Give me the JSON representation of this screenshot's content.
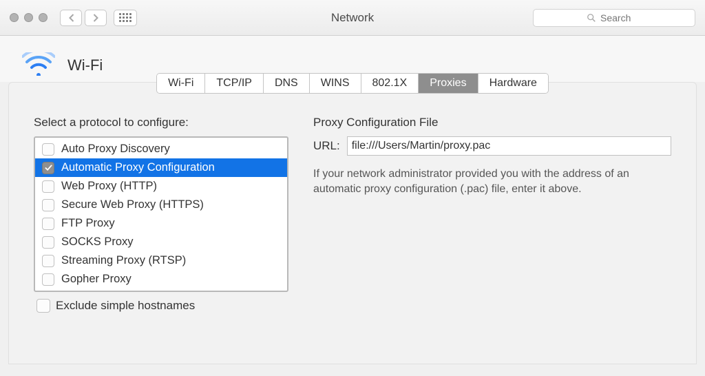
{
  "window": {
    "title": "Network",
    "search_placeholder": "Search"
  },
  "interface": {
    "name": "Wi-Fi"
  },
  "tabs": [
    {
      "label": "Wi-Fi",
      "active": false
    },
    {
      "label": "TCP/IP",
      "active": false
    },
    {
      "label": "DNS",
      "active": false
    },
    {
      "label": "WINS",
      "active": false
    },
    {
      "label": "802.1X",
      "active": false
    },
    {
      "label": "Proxies",
      "active": true
    },
    {
      "label": "Hardware",
      "active": false
    }
  ],
  "left": {
    "heading": "Select a protocol to configure:",
    "protocols": [
      {
        "label": "Auto Proxy Discovery",
        "checked": false,
        "selected": false
      },
      {
        "label": "Automatic Proxy Configuration",
        "checked": true,
        "selected": true
      },
      {
        "label": "Web Proxy (HTTP)",
        "checked": false,
        "selected": false
      },
      {
        "label": "Secure Web Proxy (HTTPS)",
        "checked": false,
        "selected": false
      },
      {
        "label": "FTP Proxy",
        "checked": false,
        "selected": false
      },
      {
        "label": "SOCKS Proxy",
        "checked": false,
        "selected": false
      },
      {
        "label": "Streaming Proxy (RTSP)",
        "checked": false,
        "selected": false
      },
      {
        "label": "Gopher Proxy",
        "checked": false,
        "selected": false
      }
    ],
    "exclude_label": "Exclude simple hostnames",
    "exclude_checked": false
  },
  "right": {
    "heading": "Proxy Configuration File",
    "url_label": "URL:",
    "url_value": "file:///Users/Martin/proxy.pac",
    "help_text": "If your network administrator provided you with the address of an automatic proxy configuration (.pac) file, enter it above."
  }
}
